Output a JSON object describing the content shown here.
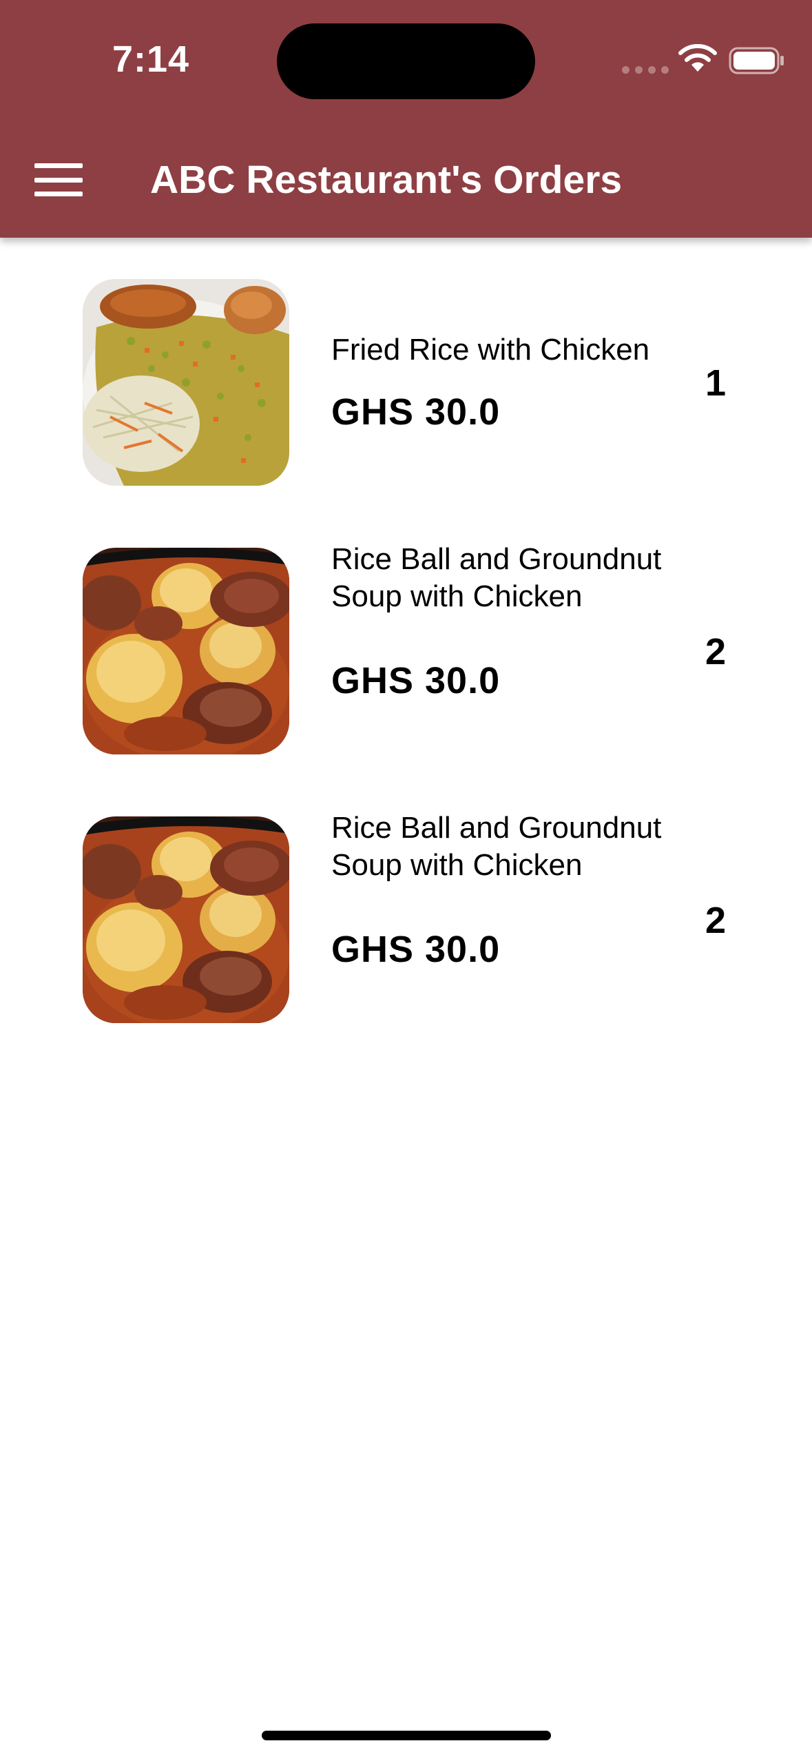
{
  "status_bar": {
    "time": "7:14",
    "icons": [
      "cellular-signal-icon",
      "wifi-icon",
      "battery-icon"
    ]
  },
  "app_bar": {
    "title": "ABC Restaurant's Orders",
    "menu_icon": "hamburger-menu-icon",
    "background_color": "#8e3f43",
    "text_color": "#ffffff"
  },
  "orders": [
    {
      "name": "Fried Rice with Chicken",
      "price": "GHS 30.0",
      "quantity": "1",
      "image": "fried-rice-with-chicken-photo"
    },
    {
      "name": "Rice Ball and Groundnut Soup with Chicken",
      "price": "GHS 30.0",
      "quantity": "2",
      "image": "groundnut-soup-photo"
    },
    {
      "name": "Rice Ball and Groundnut Soup with Chicken",
      "price": "GHS 30.0",
      "quantity": "2",
      "image": "groundnut-soup-photo"
    }
  ]
}
